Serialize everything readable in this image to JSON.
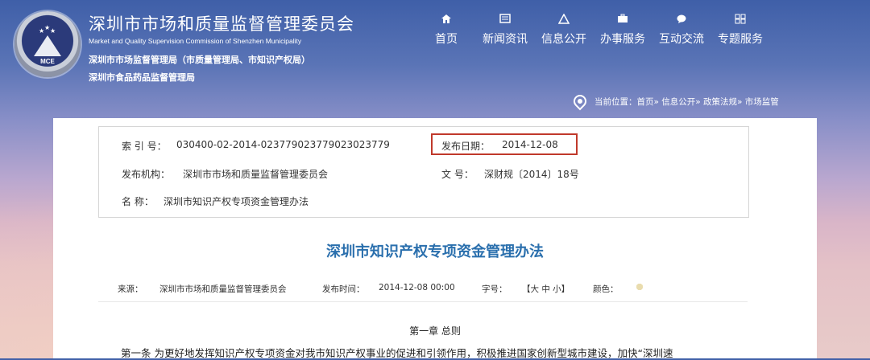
{
  "header": {
    "org_title": "深圳市市场和质量监督管理委员会",
    "org_en": "Market and Quality Supervision Commission of Shenzhen Municipality",
    "org_sub1": "深圳市市场监督管理局（市质量管理局、市知识产权局）",
    "org_sub2": "深圳市食品药品监督管理局",
    "logo_text": "MCE"
  },
  "nav": [
    {
      "label": "首页",
      "icon": "home-icon"
    },
    {
      "label": "新闻资讯",
      "icon": "news-icon"
    },
    {
      "label": "信息公开",
      "icon": "triangle-icon"
    },
    {
      "label": "办事服务",
      "icon": "briefcase-icon"
    },
    {
      "label": "互动交流",
      "icon": "chat-icon"
    },
    {
      "label": "专题服务",
      "icon": "grid-icon"
    }
  ],
  "breadcrumb": "当前位置：首页» 信息公开» 政策法规» 市场监管",
  "meta": {
    "index_label": "索 引 号：",
    "index_value": "030400-02-2014-023779023779023023779",
    "date_label": "发布日期：",
    "date_value": "2014-12-08",
    "publisher_label": "发布机构：",
    "publisher_value": "深圳市市场和质量监督管理委员会",
    "doc_no_label": "文 号：",
    "doc_no_value": "深财规〔2014〕18号",
    "name_label": "名 称：",
    "name_value": "深圳市知识产权专项资金管理办法"
  },
  "article": {
    "title": "深圳市知识产权专项资金管理办法",
    "source_label": "来源：",
    "source_value": "深圳市市场和质量监督管理委员会",
    "time_label": "发布时间：",
    "time_value": "2014-12-08 00:00",
    "font_label": "字号：",
    "font_options": "【大 中 小】",
    "color_label": "颜色：",
    "color_swatches": [
      "#f3e9c8",
      "#efe3b8",
      "#ead9a6",
      "#f0e6c4",
      "#e8dcae",
      "#f4ecd2",
      "#ece0b4",
      "#f1e7c6",
      "#e9dcae"
    ],
    "chapter": "第一章 总则",
    "first_line": "第一条 为更好地发挥知识产权专项资金对我市知识产权事业的促进和引领作用，积极推进国家创新型城市建设，加快“深圳速"
  }
}
